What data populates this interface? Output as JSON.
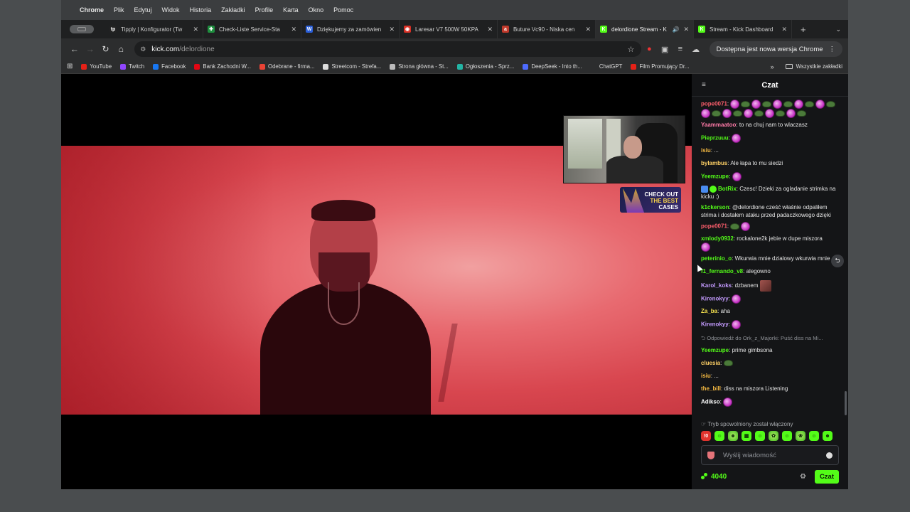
{
  "menubar": {
    "app": "Chrome",
    "items": [
      "Plik",
      "Edytuj",
      "Widok",
      "Historia",
      "Zakładki",
      "Profile",
      "Karta",
      "Okno",
      "Pomoc"
    ]
  },
  "tabs": [
    {
      "title": "Tipply | Konfigurator (Tw",
      "color": "#222222",
      "glyph": "tp"
    },
    {
      "title": "Check-Liste Service-Sta",
      "color": "#1e8e3e",
      "glyph": "✚"
    },
    {
      "title": "Dziękujemy za zamówien",
      "color": "#2b5fd9",
      "glyph": "W"
    },
    {
      "title": "Laresar V7 500W 50KPA",
      "color": "#d93025",
      "glyph": "◉"
    },
    {
      "title": "Buture Vc90 - Niska cen",
      "color": "#c0392b",
      "glyph": "a"
    },
    {
      "title": "delordione Stream - K",
      "color": "#53fc18",
      "glyph": "K",
      "active": true
    },
    {
      "title": "Stream - Kick Dashboard",
      "color": "#53fc18",
      "glyph": "K"
    }
  ],
  "toolbar": {
    "url_host": "kick.com",
    "url_path": "/delordione",
    "update_label": "Dostępna jest nowa wersja Chrome"
  },
  "bookmarks": [
    {
      "label": "YouTube",
      "color": "#e62117"
    },
    {
      "label": "Twitch",
      "color": "#9146ff"
    },
    {
      "label": "Facebook",
      "color": "#1877f2"
    },
    {
      "label": "Bank Zachodni W...",
      "color": "#e30613"
    },
    {
      "label": "Odebrane - firma...",
      "color": "#ea4335"
    },
    {
      "label": "Streetcom - Strefa...",
      "color": "#dddddd"
    },
    {
      "label": "Strona główna - St...",
      "color": "#bbbbbb"
    },
    {
      "label": "Ogłoszenia - Sprz...",
      "color": "#23b5a5"
    },
    {
      "label": "DeepSeek - Into th...",
      "color": "#4d6bfe"
    },
    {
      "label": "ChatGPT",
      "color": "#2c2d2e"
    },
    {
      "label": "Film Promujący Dr...",
      "color": "#e62117"
    }
  ],
  "bookmarks_all": "Wszystkie zakładki",
  "promo": {
    "line1": "CHECK OUT",
    "line2": "THE BEST",
    "line3": "CASES"
  },
  "chat": {
    "title": "Czat",
    "messages": [
      {
        "user": "pope0071",
        "color": "#ff5f6d",
        "text": "",
        "emotes": [
          "p",
          "f",
          "p",
          "f",
          "p",
          "f",
          "p",
          "f",
          "p",
          "f",
          "p",
          "f",
          "p",
          "f",
          "p",
          "f",
          "p",
          "f",
          "p",
          "f"
        ]
      },
      {
        "user": "Yaammaatoo",
        "color": "#ff7aa8",
        "text": "to na chuj nam to wlaczasz",
        "emotes": []
      },
      {
        "user": "Pieprzuuu",
        "color": "#53fc18",
        "text": "",
        "emotes": [
          "p"
        ]
      },
      {
        "user": "isiu",
        "color": "#f4b942",
        "text": "...",
        "emotes": []
      },
      {
        "user": "bylambus",
        "color": "#ffd166",
        "text": "Ale łapa to mu siedzi",
        "emotes": []
      },
      {
        "user": "Yeemzupe",
        "color": "#53fc18",
        "text": "",
        "emotes": [
          "p"
        ]
      },
      {
        "user": "BotRix",
        "color": "#53fc18",
        "text": "Czesc! Dzieki za ogladanie strimka na kicku :)",
        "emotes": [],
        "badges": true
      },
      {
        "user": "k1ckerson",
        "color": "#53fc18",
        "text": "@delordione cześć właśnie odpaliłem strima i dostałem ataku przed padaczkowego dzięki",
        "emotes": []
      },
      {
        "user": "pope0071",
        "color": "#ff5f6d",
        "text": "",
        "emotes": [
          "f",
          "p"
        ]
      },
      {
        "user": "xmlody0932",
        "color": "#53fc18",
        "text": "rockalone2k jebie w dupe miszora",
        "emotes": [
          "p"
        ],
        "emotes_below": true
      },
      {
        "user": "peterinio_o",
        "color": "#53fc18",
        "text": "Wkurwia mnie dzialowy wkurwia mnie",
        "emotes": []
      },
      {
        "user": "f1_fernando_v8",
        "color": "#53fc18",
        "text": "alegowno",
        "emotes": []
      },
      {
        "user": "Karol_koks",
        "color": "#c49bff",
        "text": "dzbanem",
        "emotes": [
          "photo"
        ]
      },
      {
        "user": "Kirenokyy",
        "color": "#c49bff",
        "text": "",
        "emotes": [
          "p"
        ]
      },
      {
        "user": "Za_ba",
        "color": "#f4e04d",
        "text": "aha",
        "emotes": []
      },
      {
        "user": "Kirenokyy",
        "color": "#c49bff",
        "text": "",
        "emotes": [
          "p"
        ]
      },
      {
        "user": "Yeemzupe",
        "color": "#53fc18",
        "text": "prime gimbsona",
        "emotes": [],
        "reply": "Odpowiedź do Ork_z_Majorki: Puść diss na Mi..."
      },
      {
        "user": "cluesia",
        "color": "#ffd166",
        "text": "",
        "emotes": [
          "f"
        ]
      },
      {
        "user": "isiu",
        "color": "#f4b942",
        "text": "...",
        "emotes": []
      },
      {
        "user": "the_bill",
        "color": "#f4b942",
        "text": "diss na miszora Listening",
        "emotes": []
      },
      {
        "user": "Adikso",
        "color": "#ffffff",
        "text": "",
        "emotes": [
          "p"
        ]
      }
    ],
    "slow_mode": "Tryb spowolniony został włączony",
    "input_placeholder": "Wyślij wiadomość",
    "points": "4040",
    "send_label": "Czat"
  }
}
